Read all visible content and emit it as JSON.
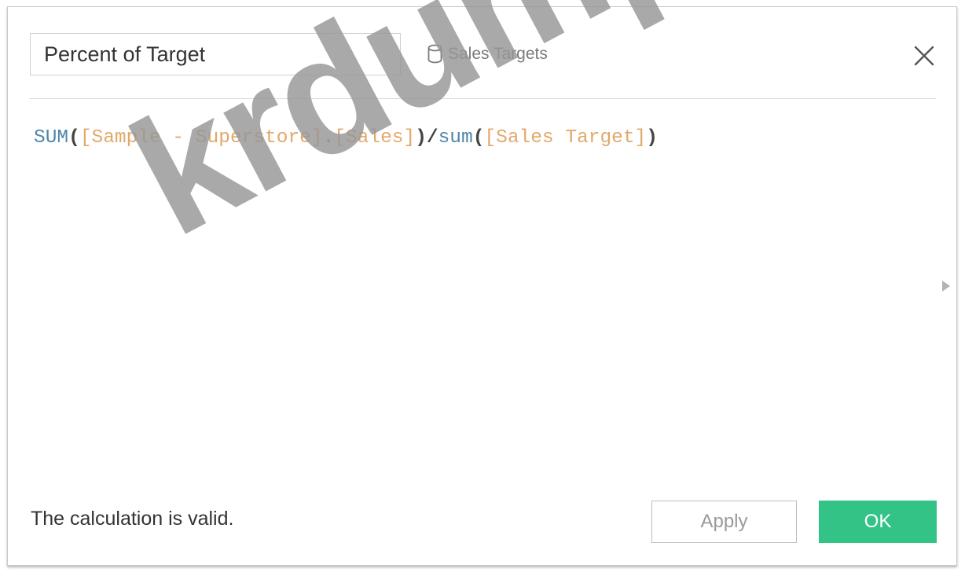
{
  "calc_editor": {
    "name_value": "Percent of Target",
    "datasource_icon": "database-icon",
    "datasource_name": "Sales Targets",
    "close_icon": "close-icon",
    "formula": {
      "fn1": "SUM",
      "open1": "(",
      "field1": "[Sample - Superstore]",
      "dot": ".",
      "field2": "[Sales]",
      "close1": ")",
      "slash": "/",
      "fn2": "sum",
      "open2": "(",
      "field3": "[Sales Target]",
      "close2": ")"
    },
    "expand_icon": "expand-arrow-icon",
    "status_text": "The calculation is valid.",
    "apply_label": "Apply",
    "ok_label": "OK",
    "watermark": "krdump",
    "colors": {
      "ok_button": "#34c387",
      "function": "#4e86a8",
      "field": "#e2a86a"
    }
  }
}
